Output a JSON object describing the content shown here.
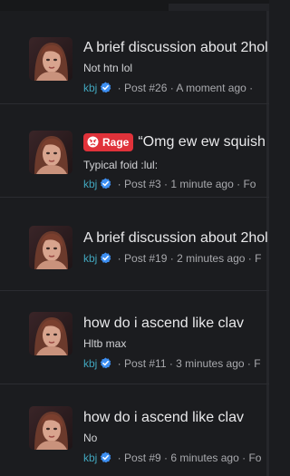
{
  "colors": {
    "background": "#1b1c1f",
    "title_text": "#e8e8ea",
    "username": "#41a6bd",
    "meta_text": "#a8a9ad",
    "rage_badge": "#e0323a",
    "verified_badge": "#3d8ff2"
  },
  "feed": {
    "items": [
      {
        "title": "A brief discussion about 2hol",
        "snippet": "Not htn lol",
        "username": "kbj",
        "verified_icon": "verified-badge-icon",
        "post": "Post #26",
        "time": "A moment ago",
        "tail": "·"
      },
      {
        "badge": {
          "label": "Rage",
          "icon": "angry-face-icon"
        },
        "title": "“Omg ew ew squish",
        "snippet": "Typical foid :lul:",
        "username": "kbj",
        "verified_icon": "verified-badge-icon",
        "post": "Post #3",
        "time": "1 minute ago",
        "tail": "Fo"
      },
      {
        "title": "A brief discussion about 2hol",
        "snippet": "",
        "username": "kbj",
        "verified_icon": "verified-badge-icon",
        "post": "Post #19",
        "time": "2 minutes ago",
        "tail": "F"
      },
      {
        "title": "how do i ascend like clav",
        "snippet": "Hltb max",
        "username": "kbj",
        "verified_icon": "verified-badge-icon",
        "post": "Post #11",
        "time": "3 minutes ago",
        "tail": "F"
      },
      {
        "title": "how do i ascend like clav",
        "snippet": "No",
        "username": "kbj",
        "verified_icon": "verified-badge-icon",
        "post": "Post #9",
        "time": "6 minutes ago",
        "tail": "Fo"
      }
    ]
  }
}
